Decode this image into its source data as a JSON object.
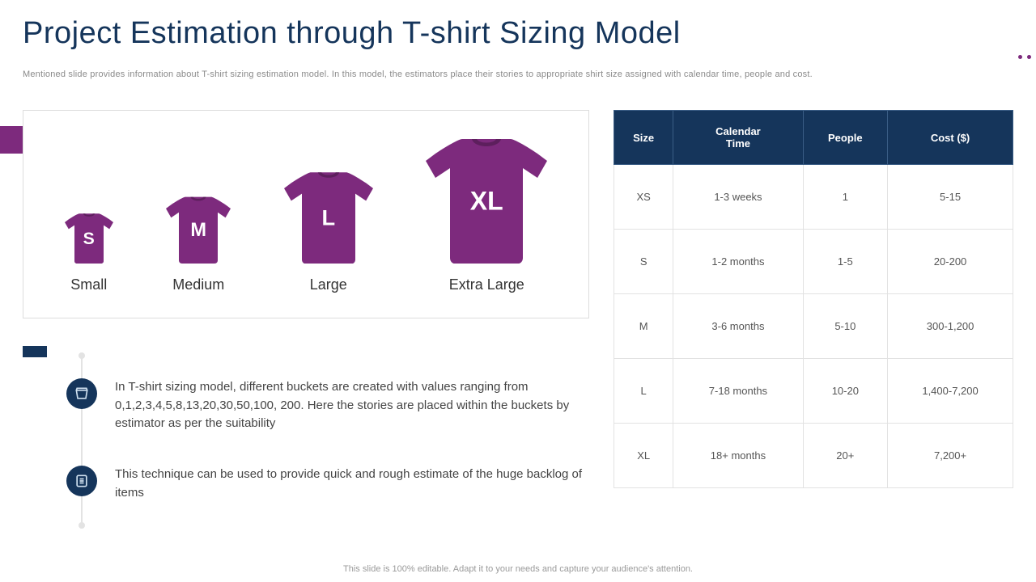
{
  "title": "Project Estimation through T-shirt Sizing Model",
  "subtitle": "Mentioned slide provides information about T-shirt sizing estimation model. In this model, the estimators place their stories to appropriate shirt size assigned with calendar time, people and cost.",
  "footer": "This slide is 100% editable. Adapt it to your needs and capture your audience's attention.",
  "colors": {
    "accent": "#7d2a7d",
    "navy": "#15355b"
  },
  "shirts": [
    {
      "letter": "S",
      "label": "Small",
      "scale": 60
    },
    {
      "letter": "M",
      "label": "Medium",
      "scale": 80
    },
    {
      "letter": "L",
      "label": "Large",
      "scale": 110
    },
    {
      "letter": "XL",
      "label": "Extra Large",
      "scale": 150
    }
  ],
  "descriptions": [
    "In T-shirt sizing model, different buckets are created with values ranging from 0,1,2,3,4,5,8,13,20,30,50,100, 200. Here the stories are placed within the buckets by estimator as per the suitability",
    "This technique can be used to provide quick and rough estimate of the huge backlog of items"
  ],
  "table": {
    "headers": [
      "Size",
      "Calendar Time",
      "People",
      "Cost ($)"
    ],
    "rows": [
      [
        "XS",
        "1-3 weeks",
        "1",
        "5-15"
      ],
      [
        "S",
        "1-2 months",
        "1-5",
        "20-200"
      ],
      [
        "M",
        "3-6 months",
        "5-10",
        "300-1,200"
      ],
      [
        "L",
        "7-18 months",
        "10-20",
        "1,400-7,200"
      ],
      [
        "XL",
        "18+ months",
        "20+",
        "7,200+"
      ]
    ]
  },
  "chart_data": {
    "type": "table",
    "title": "T-shirt Sizing Estimation Model",
    "columns": [
      "Size",
      "Calendar Time",
      "People",
      "Cost ($)"
    ],
    "rows": [
      {
        "Size": "XS",
        "Calendar Time": "1-3 weeks",
        "People": "1",
        "Cost ($)": "5-15"
      },
      {
        "Size": "S",
        "Calendar Time": "1-2 months",
        "People": "1-5",
        "Cost ($)": "20-200"
      },
      {
        "Size": "M",
        "Calendar Time": "3-6 months",
        "People": "5-10",
        "Cost ($)": "300-1,200"
      },
      {
        "Size": "L",
        "Calendar Time": "7-18 months",
        "People": "10-20",
        "Cost ($)": "1,400-7,200"
      },
      {
        "Size": "XL",
        "Calendar Time": "18+ months",
        "People": "20+",
        "Cost ($)": "7,200+"
      }
    ]
  }
}
